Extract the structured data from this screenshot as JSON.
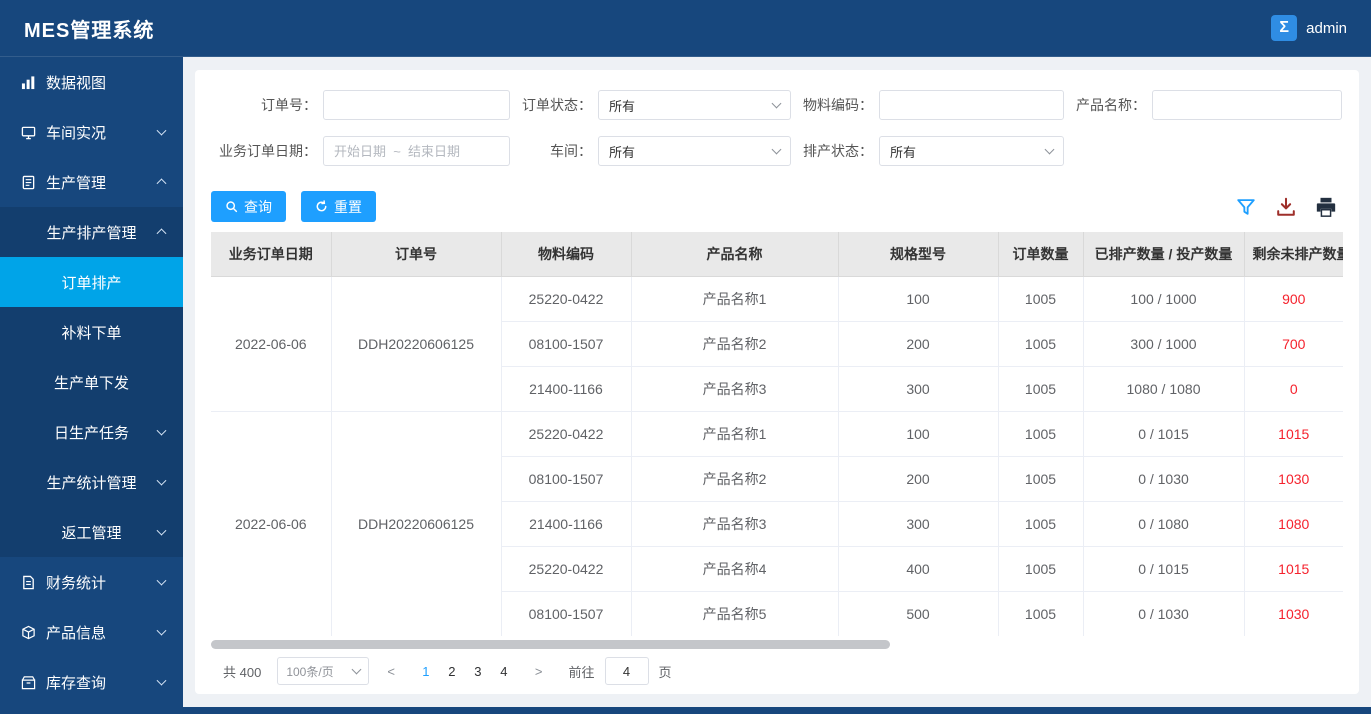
{
  "app": {
    "title": "MES管理系统",
    "user": "admin",
    "avatar_glyph": "Σ"
  },
  "sidebar": {
    "items": [
      {
        "id": "data-view",
        "label": "数据视图",
        "icon": "bar-chart-icon",
        "level": 1
      },
      {
        "id": "workshop-live",
        "label": "车间实况",
        "icon": "monitor-icon",
        "level": 1,
        "chevron": "down"
      },
      {
        "id": "production-mgmt",
        "label": "生产管理",
        "icon": "clipboard-icon",
        "level": 1,
        "chevron": "up"
      },
      {
        "id": "production-schedule-mgmt",
        "label": "生产排产管理",
        "level": 2,
        "chevron": "up"
      },
      {
        "id": "order-scheduling",
        "label": "订单排产",
        "level": 3,
        "active": true
      },
      {
        "id": "replenish-order",
        "label": "补料下单",
        "level": 3
      },
      {
        "id": "production-order-issue",
        "label": "生产单下发",
        "level": 3
      },
      {
        "id": "daily-production-task",
        "label": "日生产任务",
        "level": 3,
        "chevron": "down"
      },
      {
        "id": "production-stats-mgmt",
        "label": "生产统计管理",
        "level": 2,
        "chevron": "down"
      },
      {
        "id": "rework-mgmt",
        "label": "返工管理",
        "level": 2,
        "chevron": "down"
      },
      {
        "id": "finance-stats",
        "label": "财务统计",
        "icon": "document-icon",
        "level": 1,
        "chevron": "down"
      },
      {
        "id": "product-info",
        "label": "产品信息",
        "icon": "cube-icon",
        "level": 1,
        "chevron": "down"
      },
      {
        "id": "inventory-query",
        "label": "库存查询",
        "icon": "box-icon",
        "level": 1,
        "chevron": "down"
      }
    ]
  },
  "filters": {
    "order_no_label": "订单号：",
    "order_status_label": "订单状态：",
    "order_status_value": "所有",
    "material_code_label": "物料编码：",
    "product_name_label": "产品名称：",
    "date_label": "业务订单日期：",
    "date_placeholder": "开始日期  ~  结束日期",
    "workshop_label": "车间：",
    "workshop_value": "所有",
    "schedule_status_label": "排产状态：",
    "schedule_status_value": "所有"
  },
  "toolbar": {
    "search_label": "查询",
    "reset_label": "重置"
  },
  "table": {
    "headers": [
      "业务订单日期",
      "订单号",
      "物料编码",
      "产品名称",
      "规格型号",
      "订单数量",
      "已排产数量 / 投产数量",
      "剩余未排产数量"
    ],
    "groups": [
      {
        "date": "2022-06-06",
        "order_no": "DDH20220606125",
        "rows": [
          {
            "material": "25220-0422",
            "product": "产品名称1",
            "spec": "100",
            "qty": "1005",
            "scheduled": "100 / 1000",
            "remaining": "900"
          },
          {
            "material": "08100-1507",
            "product": "产品名称2",
            "spec": "200",
            "qty": "1005",
            "scheduled": "300 / 1000",
            "remaining": "700"
          },
          {
            "material": "21400-1166",
            "product": "产品名称3",
            "spec": "300",
            "qty": "1005",
            "scheduled": "1080 / 1080",
            "remaining": "0"
          }
        ]
      },
      {
        "date": "2022-06-06",
        "order_no": "DDH20220606125",
        "rows": [
          {
            "material": "25220-0422",
            "product": "产品名称1",
            "spec": "100",
            "qty": "1005",
            "scheduled": "0 / 1015",
            "remaining": "1015"
          },
          {
            "material": "08100-1507",
            "product": "产品名称2",
            "spec": "200",
            "qty": "1005",
            "scheduled": "0 / 1030",
            "remaining": "1030"
          },
          {
            "material": "21400-1166",
            "product": "产品名称3",
            "spec": "300",
            "qty": "1005",
            "scheduled": "0 / 1080",
            "remaining": "1080"
          },
          {
            "material": "25220-0422",
            "product": "产品名称4",
            "spec": "400",
            "qty": "1005",
            "scheduled": "0 / 1015",
            "remaining": "1015"
          },
          {
            "material": "08100-1507",
            "product": "产品名称5",
            "spec": "500",
            "qty": "1005",
            "scheduled": "0 / 1030",
            "remaining": "1030"
          }
        ]
      }
    ]
  },
  "pagination": {
    "total": "共 400",
    "page_size": "100条/页",
    "prev_label": "<",
    "next_label": ">",
    "pages": [
      "1",
      "2",
      "3",
      "4"
    ],
    "active_page": "1",
    "goto_label": "前往",
    "goto_value": "4",
    "page_suffix": "页"
  },
  "colors": {
    "accent": "#1e9fff",
    "sidebar_bg": "#17477d",
    "submenu_bg": "#133e6e",
    "active_menu": "#00a4e8",
    "danger_text": "#f5222d",
    "table_header_bg": "#e9e9e9"
  }
}
